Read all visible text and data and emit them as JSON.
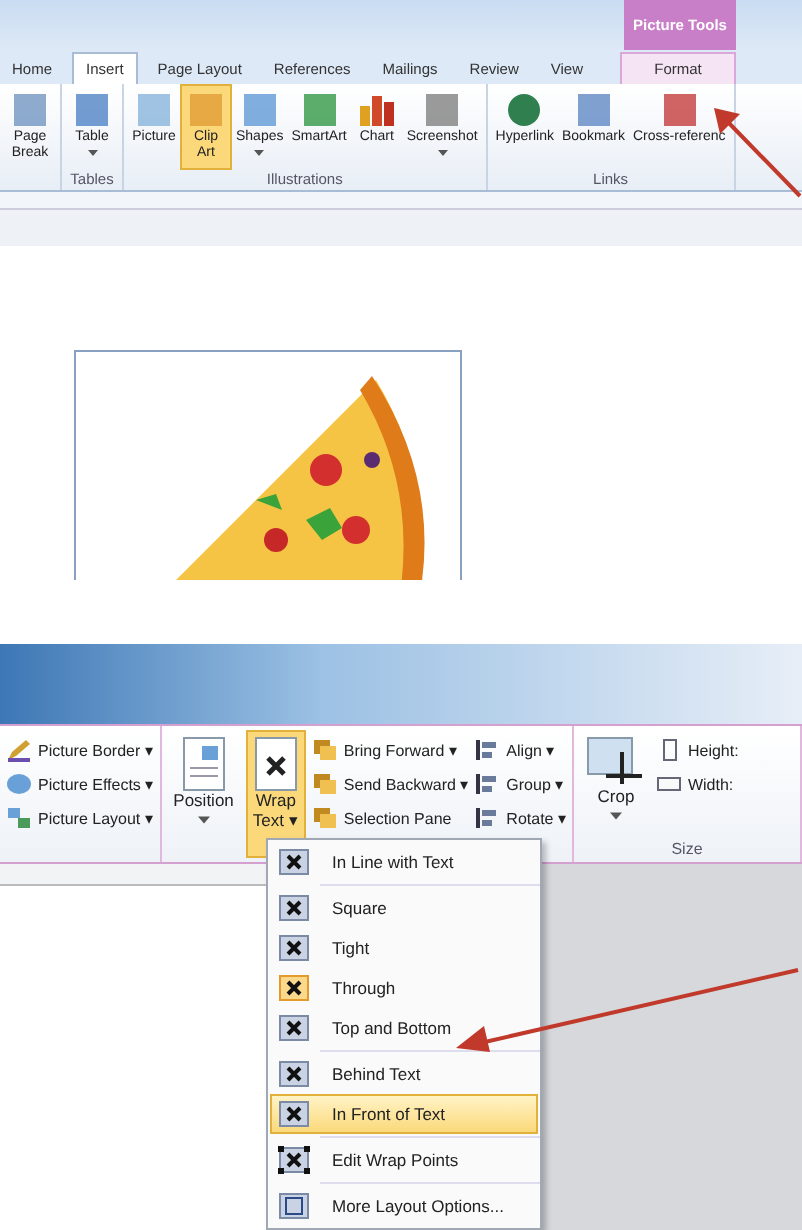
{
  "top": {
    "tabs": [
      {
        "label": "Home",
        "selected": false
      },
      {
        "label": "Insert",
        "selected": true
      },
      {
        "label": "Page Layout",
        "selected": false
      },
      {
        "label": "References",
        "selected": false
      },
      {
        "label": "Mailings",
        "selected": false
      },
      {
        "label": "Review",
        "selected": false
      },
      {
        "label": "View",
        "selected": false
      }
    ],
    "contextual": {
      "title": "Picture Tools",
      "tab": "Format"
    },
    "groups": [
      {
        "buttons": [
          {
            "label": "Page Break",
            "kind": "pagebreak",
            "selected": false,
            "dropdown": false
          }
        ]
      },
      {
        "label": "Tables",
        "buttons": [
          {
            "label": "Table",
            "kind": "table",
            "selected": false,
            "dropdown": true
          }
        ]
      },
      {
        "label": "Illustrations",
        "buttons": [
          {
            "label": "Picture",
            "kind": "picture",
            "selected": false,
            "dropdown": false
          },
          {
            "label": "Clip Art",
            "kind": "clipart",
            "selected": true,
            "dropdown": false
          },
          {
            "label": "Shapes",
            "kind": "shapes",
            "selected": false,
            "dropdown": true
          },
          {
            "label": "SmartArt",
            "kind": "smartart",
            "selected": false,
            "dropdown": false
          },
          {
            "label": "Chart",
            "kind": "chart",
            "selected": false,
            "dropdown": false
          },
          {
            "label": "Screenshot",
            "kind": "screenshot",
            "selected": false,
            "dropdown": true
          }
        ]
      },
      {
        "label": "Links",
        "buttons": [
          {
            "label": "Hyperlink",
            "kind": "globe",
            "selected": false,
            "dropdown": false
          },
          {
            "label": "Bookmark",
            "kind": "bookmark",
            "selected": false,
            "dropdown": false
          },
          {
            "label": "Cross-referenc",
            "kind": "crossref",
            "selected": false,
            "dropdown": false
          }
        ]
      }
    ]
  },
  "bottom": {
    "picture_styles": [
      {
        "label": "Picture Border ▾",
        "kind": "border"
      },
      {
        "label": "Picture Effects ▾",
        "kind": "effects"
      },
      {
        "label": "Picture Layout ▾",
        "kind": "layout"
      }
    ],
    "arrange": {
      "position": {
        "label": "Position",
        "selected": false,
        "dropdown": true
      },
      "wrap": {
        "label": "Wrap Text ▾",
        "selected": true
      },
      "column_1": [
        "Bring Forward ▾",
        "Send Backward ▾",
        "Selection Pane"
      ],
      "column_2": [
        "Align ▾",
        "Group ▾",
        "Rotate ▾"
      ]
    },
    "size": {
      "crop": "Crop",
      "crop_dropdown": true,
      "height": "Height:",
      "width": "Width:",
      "label": "Size"
    },
    "wrap_menu": [
      [
        {
          "label": "In Line with Text",
          "checked": false,
          "hovered": false,
          "kind": "wrap"
        }
      ],
      [
        {
          "label": "Square",
          "checked": false,
          "hovered": false,
          "kind": "wrap"
        },
        {
          "label": "Tight",
          "checked": false,
          "hovered": false,
          "kind": "wrap"
        },
        {
          "label": "Through",
          "checked": true,
          "hovered": false,
          "kind": "wrap"
        },
        {
          "label": "Top and Bottom",
          "checked": false,
          "hovered": false,
          "kind": "wrap"
        }
      ],
      [
        {
          "label": "Behind Text",
          "checked": false,
          "hovered": false,
          "kind": "wrap"
        },
        {
          "label": "In Front of Text",
          "checked": false,
          "hovered": true,
          "kind": "wrap"
        }
      ],
      [
        {
          "label": "Edit Wrap Points",
          "checked": false,
          "hovered": false,
          "kind": "points"
        }
      ],
      [
        {
          "label": "More Layout Options...",
          "checked": false,
          "hovered": false,
          "kind": "layout"
        }
      ]
    ]
  }
}
